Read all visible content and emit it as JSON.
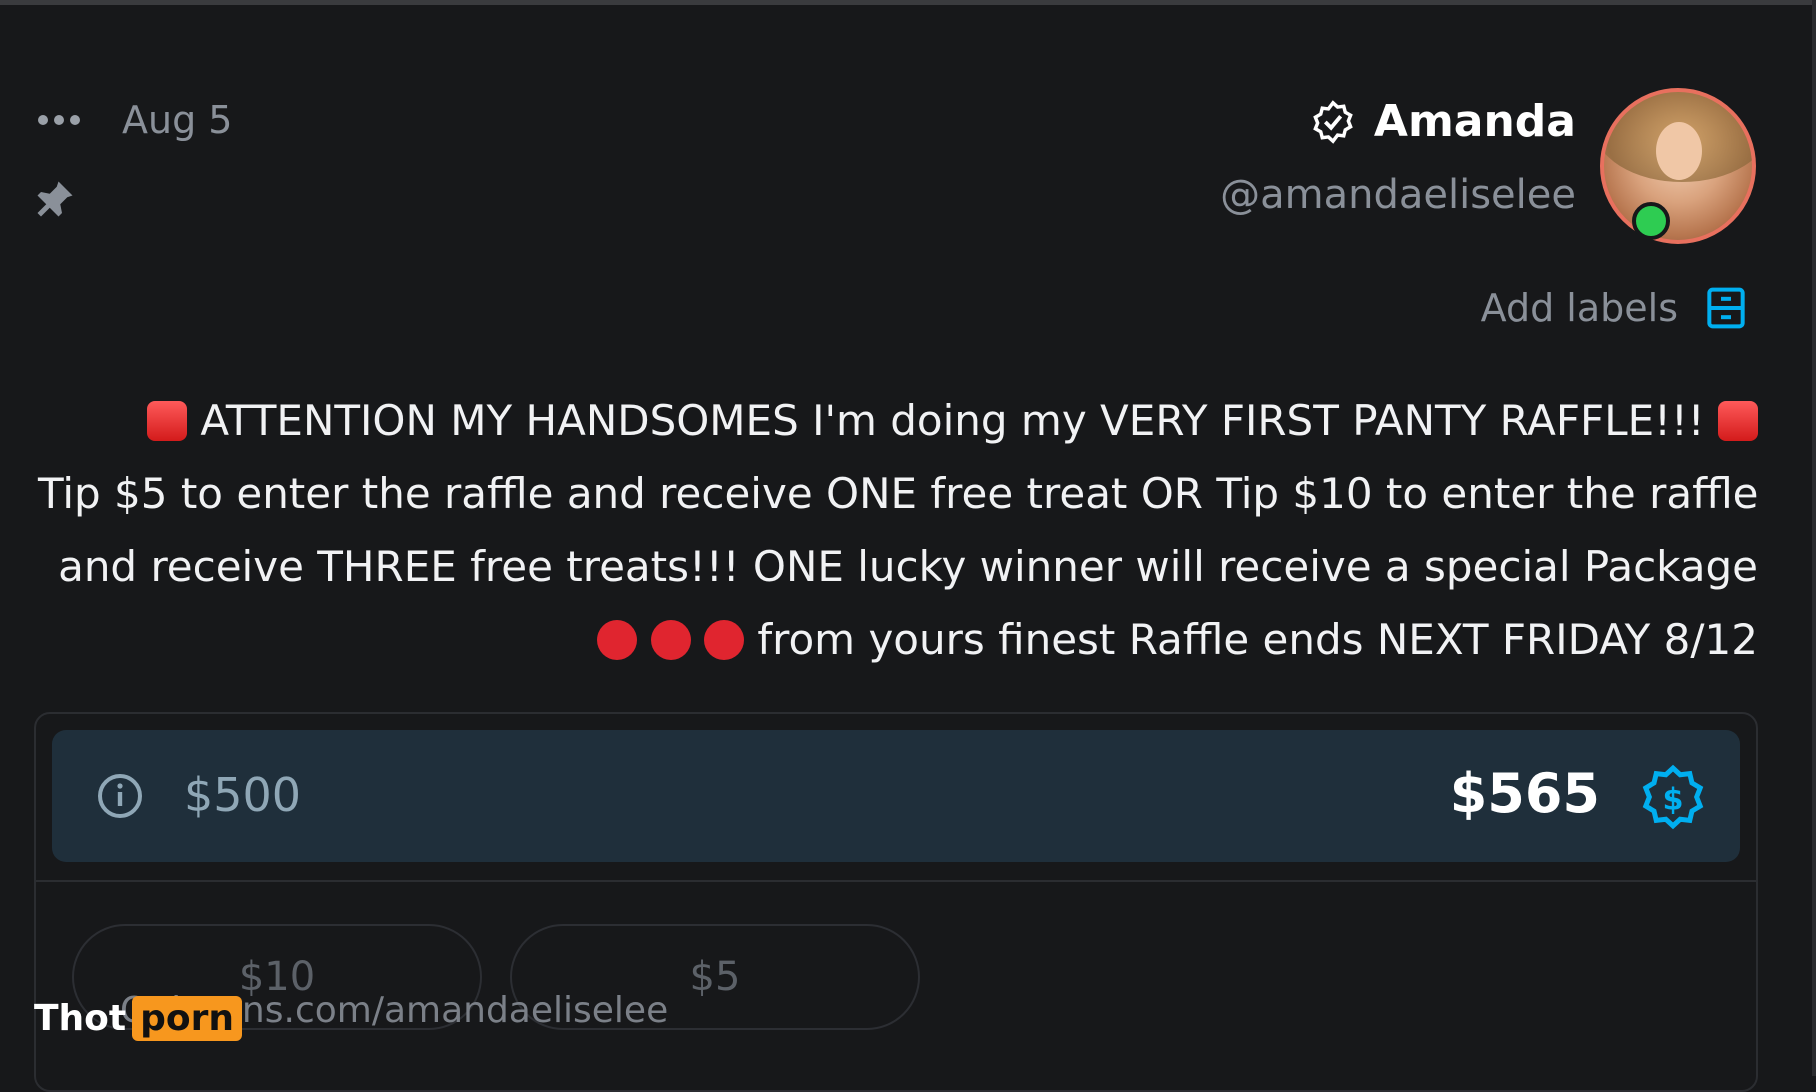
{
  "header": {
    "date": "Aug 5",
    "author_name": "Amanda",
    "author_handle": "@amandaeliselee",
    "add_labels": "Add labels"
  },
  "post": {
    "lines": [
      "ATTENTION MY HANDSOMES I'm doing my VERY FIRST PANTY RAFFLE!!!",
      "Tip $5 to enter the raffle and receive ONE free treat OR Tip $10 to enter the raffle",
      "and receive THREE free treats!!! ONE lucky winner will receive a special Package",
      "from yours finest Raffle ends NEXT FRIDAY 8/12"
    ]
  },
  "goal": {
    "amount": "$565",
    "target": "$500"
  },
  "tip_options": [
    "$5",
    "$10"
  ],
  "watermark": {
    "url": "OnlyFans.com/amandaeliselee",
    "brand_a": "Thot",
    "brand_b": "porn"
  },
  "colors": {
    "background": "#17181a",
    "goal_bg": "#1f2f3b",
    "accent": "#00aff0",
    "online": "#2ecc52",
    "avatar_ring": "#e8705e"
  },
  "icons": [
    "more-icon",
    "pin-icon",
    "verified-icon",
    "labels-icon",
    "info-icon",
    "tip-goal-icon"
  ]
}
